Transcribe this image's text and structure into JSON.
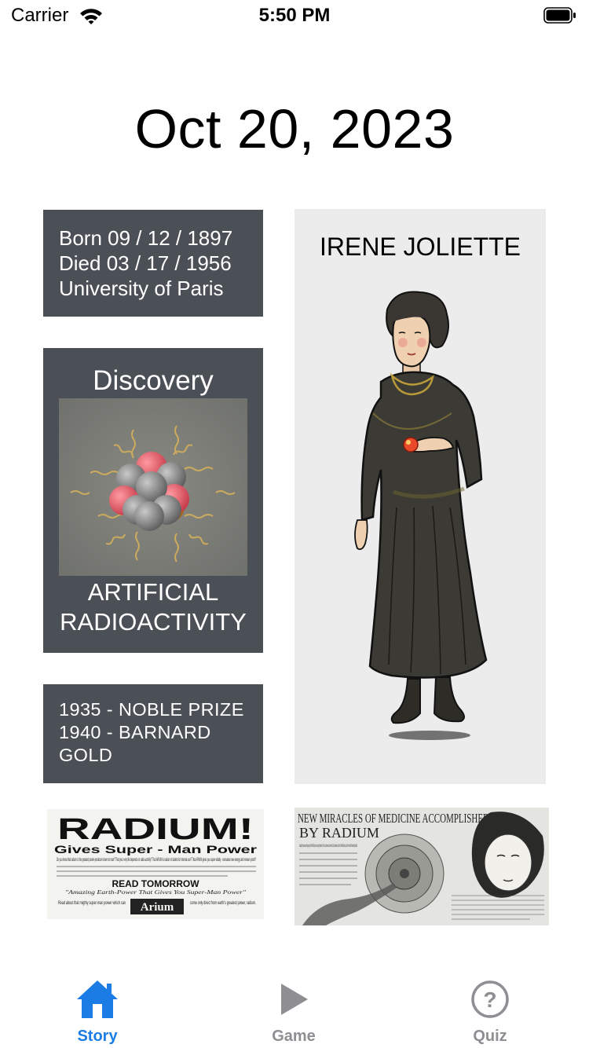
{
  "status_bar": {
    "carrier": "Carrier",
    "time": "5:50 PM"
  },
  "header": {
    "date": "Oct 20, 2023"
  },
  "bio": {
    "lines": [
      "Born 09 / 12 / 1897",
      "Died 03 / 17 / 1956",
      "University of Paris"
    ]
  },
  "discovery": {
    "heading": "Discovery",
    "name_lines": [
      "ARTIFICIAL",
      "RADIOACTIVITY"
    ]
  },
  "awards": {
    "lines": [
      "1935 - NOBLE PRIZE",
      "1940 - BARNARD",
      "GOLD"
    ]
  },
  "portrait": {
    "name": "IRENE JOLIETTE"
  },
  "clippings": {
    "radium_ad": {
      "headline": "RADIUM!",
      "subheadline": "Gives Super - Man Power",
      "body": "Do you know that radium is the greatest power-producer known to man? That your very life depends on radio-activity? That ARIUM is radium in tablets for internal use? That ARIUM gives you super-vitality - recreates new energy and renews youth?",
      "cta": "READ TOMORROW",
      "tagline": "\"Amazing Earth-Power That Gives You Super-Man Power\"",
      "footer_left": "Read about that mighty super-man power which can",
      "brand": "Arium",
      "footer_right": "come only direct from earth's greatest power, radium."
    },
    "medicine_article": {
      "headline_line1": "NEW MIRACLES OF MEDICINE ACCOMPLISHED",
      "headline_line2": "BY RADIUM",
      "deck": "Leading Physicians and Surgeons of the World Report a Surprising Number of Cases of Cancerous Growths Cured, Stomach and Liver Trouble Relieved, and Even Arterial Hardening Checked"
    }
  },
  "tabbar": {
    "active_color": "#1a7ce4",
    "inactive_color": "#8e8e93",
    "items": [
      {
        "label": "Story",
        "icon": "house-icon",
        "active": true
      },
      {
        "label": "Game",
        "icon": "play-icon",
        "active": false
      },
      {
        "label": "Quiz",
        "icon": "question-circle-icon",
        "active": false
      }
    ]
  }
}
